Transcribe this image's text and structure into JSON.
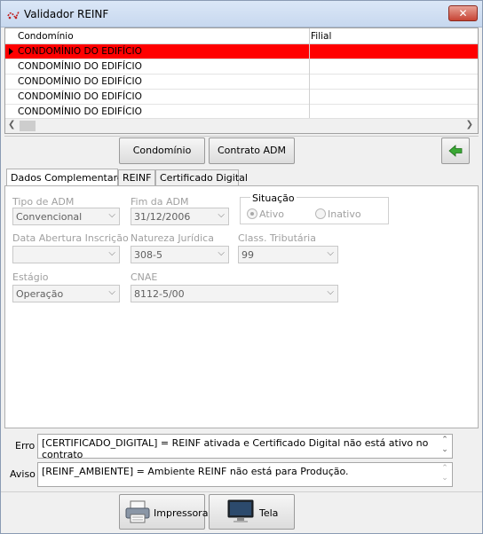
{
  "window": {
    "title": "Validador REINF",
    "close_glyph": "✕"
  },
  "grid": {
    "columns": [
      "Condomínio",
      "Filial"
    ],
    "rows": [
      {
        "condominio": "CONDOMÍNIO DO EDIFÍCIO",
        "filial": "",
        "selected": true
      },
      {
        "condominio": "CONDOMÍNIO DO EDIFÍCIO",
        "filial": ""
      },
      {
        "condominio": "CONDOMÍNIO DO EDIFÍCIO",
        "filial": ""
      },
      {
        "condominio": "CONDOMÍNIO DO EDIFÍCIO",
        "filial": ""
      },
      {
        "condominio": "CONDOMÍNIO DO EDIFÍCIO",
        "filial": ""
      }
    ],
    "selected_color": "#ff0000"
  },
  "toolbar": {
    "condominio_label": "Condomínio",
    "contrato_label": "Contrato ADM",
    "back_icon": "arrow-left-icon",
    "back_color": "#3aa834"
  },
  "tabs": [
    {
      "label": "Dados Complementares",
      "active": true
    },
    {
      "label": "REINF",
      "active": false
    },
    {
      "label": "Certificado Digital",
      "active": false
    }
  ],
  "form": {
    "tipo_adm": {
      "label": "Tipo de ADM",
      "value": "Convencional"
    },
    "fim_adm": {
      "label": "Fim da ADM",
      "value": "31/12/2006"
    },
    "situacao": {
      "label": "Situação",
      "options": [
        "Ativo",
        "Inativo"
      ],
      "selected": "Ativo"
    },
    "data_abertura": {
      "label": "Data Abertura Inscrição",
      "value": ""
    },
    "natureza": {
      "label": "Natureza Jurídica",
      "value": "308-5"
    },
    "class_trib": {
      "label": "Class. Tributária",
      "value": "99"
    },
    "estagio": {
      "label": "Estágio",
      "value": "Operação"
    },
    "cnae": {
      "label": "CNAE",
      "value": "8112-5/00"
    }
  },
  "messages": {
    "erro_label": "Erro",
    "erro_text": "[CERTIFICADO_DIGITAL] = REINF ativada e Certificado Digital não está ativo no contrato",
    "aviso_label": "Aviso",
    "aviso_text": "[REINF_AMBIENTE] = Ambiente REINF não está para Produção."
  },
  "footer": {
    "print_label": "Impressora",
    "screen_label": "Tela",
    "print_icon": "printer-icon",
    "screen_icon": "monitor-icon"
  }
}
